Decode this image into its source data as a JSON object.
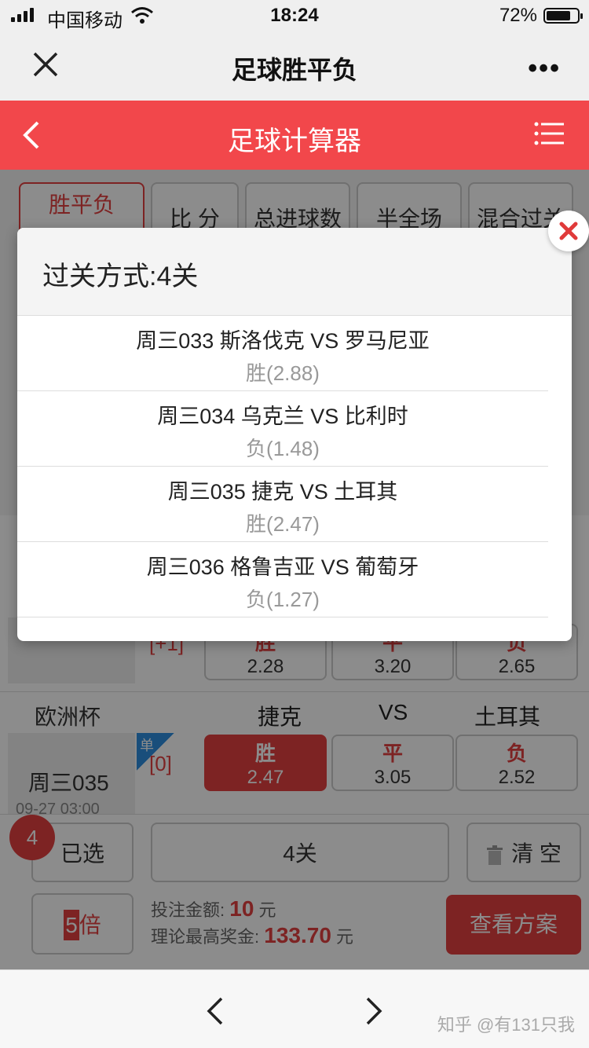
{
  "status_bar": {
    "carrier": "中国移动",
    "time": "18:24",
    "battery": "72%"
  },
  "wechat_nav": {
    "title": "足球胜平负",
    "more": "•••"
  },
  "app_header": {
    "title": "足球计算器"
  },
  "tabs": [
    "胜平负",
    "比 分",
    "总进球数",
    "半全场",
    "混合过关"
  ],
  "match_prev": {
    "handicap": "[+1]",
    "odds": [
      {
        "label": "胜",
        "value": "2.28"
      },
      {
        "label": "平",
        "value": "3.20"
      },
      {
        "label": "负",
        "value": "2.65"
      }
    ]
  },
  "match_035": {
    "league": "欧洲杯",
    "home": "捷克",
    "vs": "VS",
    "away": "土耳其",
    "code": "周三035",
    "time": "09-27 03:00",
    "badge": "单",
    "handicap": "[0]",
    "odds": [
      {
        "label": "胜",
        "value": "2.47",
        "selected": true
      },
      {
        "label": "平",
        "value": "3.05",
        "selected": false
      },
      {
        "label": "负",
        "value": "2.52",
        "selected": false
      }
    ]
  },
  "bottom": {
    "selected_count": "4",
    "selected_label": "已选",
    "pass_label": "4关",
    "clear_label": "清 空",
    "multiplier_num": "5",
    "multiplier_unit": "倍",
    "bet_amount_label": "投注金额:",
    "bet_amount": "10",
    "bet_unit": "元",
    "max_prize_label": "理论最高奖金:",
    "max_prize": "133.70",
    "max_prize_unit": "元",
    "view_plan": "查看方案"
  },
  "modal": {
    "title": "过关方式:4关",
    "items": [
      {
        "teams": "周三033 斯洛伐克 VS 罗马尼亚",
        "pick": "胜(2.88)"
      },
      {
        "teams": "周三034 乌克兰 VS 比利时",
        "pick": "负(1.48)"
      },
      {
        "teams": "周三035 捷克 VS 土耳其",
        "pick": "胜(2.47)"
      },
      {
        "teams": "周三036 格鲁吉亚 VS 葡萄牙",
        "pick": "负(1.27)"
      }
    ]
  },
  "browser": {
    "watermark": "知乎 @有131只我"
  },
  "colors": {
    "accent": "#e34040",
    "header": "#f2474b",
    "close": "#e03a3a"
  }
}
